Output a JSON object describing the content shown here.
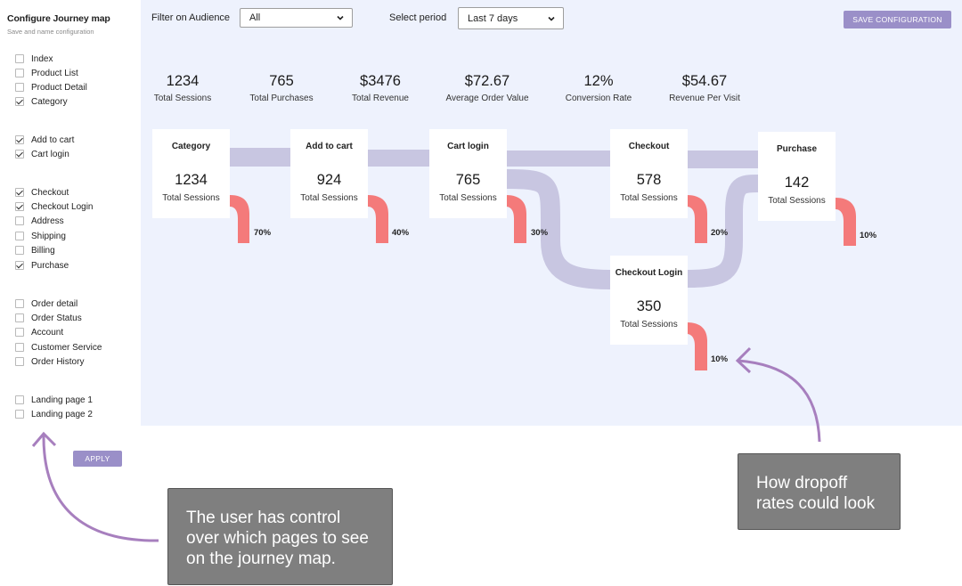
{
  "sidebar": {
    "title": "Configure Journey map",
    "subtitle": "Save and name configuration",
    "apply_label": "APPLY",
    "items": [
      {
        "label": "Index",
        "checked": false
      },
      {
        "label": "Product List",
        "checked": false
      },
      {
        "label": "Product Detail",
        "checked": false
      },
      {
        "label": "Category",
        "checked": true
      },
      {
        "label": "Add to cart",
        "checked": true
      },
      {
        "label": "Cart login",
        "checked": true
      },
      {
        "label": "Checkout",
        "checked": true
      },
      {
        "label": "Checkout Login",
        "checked": true
      },
      {
        "label": "Address",
        "checked": false
      },
      {
        "label": "Shipping",
        "checked": false
      },
      {
        "label": "Billing",
        "checked": false
      },
      {
        "label": "Purchase",
        "checked": true
      },
      {
        "label": "Order detail",
        "checked": false
      },
      {
        "label": "Order Status",
        "checked": false
      },
      {
        "label": "Account",
        "checked": false
      },
      {
        "label": "Customer Service",
        "checked": false
      },
      {
        "label": "Order History",
        "checked": false
      },
      {
        "label": "Landing page 1",
        "checked": false
      },
      {
        "label": "Landing page 2",
        "checked": false
      }
    ]
  },
  "toolbar": {
    "audience_label": "Filter on Audience",
    "audience_value": "All",
    "period_label": "Select period",
    "period_value": "Last 7 days",
    "save_label": "SAVE CONFIGURATION"
  },
  "stats": [
    {
      "value": "1234",
      "label": "Total Sessions"
    },
    {
      "value": "765",
      "label": "Total Purchases"
    },
    {
      "value": "$3476",
      "label": "Total Revenue"
    },
    {
      "value": "$72.67",
      "label": "Average Order Value"
    },
    {
      "value": "12%",
      "label": "Conversion Rate"
    },
    {
      "value": "$54.67",
      "label": "Revenue Per Visit"
    }
  ],
  "journey": {
    "nodes": [
      {
        "title": "Category",
        "value": "1234",
        "label": "Total Sessions",
        "dropoff": "70%"
      },
      {
        "title": "Add to cart",
        "value": "924",
        "label": "Total Sessions",
        "dropoff": "40%"
      },
      {
        "title": "Cart login",
        "value": "765",
        "label": "Total Sessions",
        "dropoff": "30%"
      },
      {
        "title": "Checkout",
        "value": "578",
        "label": "Total Sessions",
        "dropoff": "20%"
      },
      {
        "title": "Purchase",
        "value": "142",
        "label": "Total Sessions",
        "dropoff": "10%"
      },
      {
        "title": "Checkout Login",
        "value": "350",
        "label": "Total Sessions",
        "dropoff": "10%"
      }
    ],
    "flow_color": "#c8c6e1",
    "dropoff_color": "#f47a7a"
  },
  "annotations": {
    "left_note": "The user has control over which pages to see on the journey map.",
    "right_note": "How dropoff rates could look",
    "arrow_color": "#a77fbe"
  }
}
